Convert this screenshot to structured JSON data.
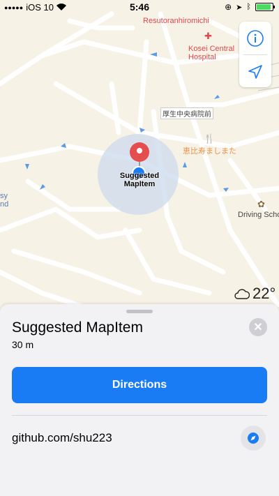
{
  "status_bar": {
    "carrier": "iOS 10",
    "signal_dots": "●●●●●",
    "wifi_icon": "wifi-icon",
    "time": "5:46",
    "icons": [
      "location-lock-icon",
      "location-arrow-icon",
      "bluetooth-icon",
      "battery-icon"
    ]
  },
  "map": {
    "labels": {
      "resutoran": "Resutoranhiromichi",
      "hospital_line1": "Kosei Central",
      "hospital_line2": "Hospital",
      "kanji_stop": "厚生中央病院前",
      "restaurant_jp": "恵比寿ましまた",
      "driving_school": "Driving Scho",
      "left_edge_1": "sy",
      "left_edge_2": "nd"
    },
    "pin_label_line1": "Suggested",
    "pin_label_line2": "MapItem",
    "colors": {
      "pin": "#e54e4e",
      "user_dot": "#1a7cf5",
      "accuracy": "#c9d8ec"
    }
  },
  "map_controls": {
    "info_icon": "info-icon",
    "tracking_icon": "location-tracking-icon"
  },
  "weather": {
    "icon": "cloud-icon",
    "temperature": "22°"
  },
  "sheet": {
    "title": "Suggested MapItem",
    "distance": "30 m",
    "directions_label": "Directions",
    "website": "github.com/shu223",
    "close_icon": "close-icon",
    "compass_icon": "compass-icon",
    "colors": {
      "accent": "#1a7cf5"
    }
  }
}
